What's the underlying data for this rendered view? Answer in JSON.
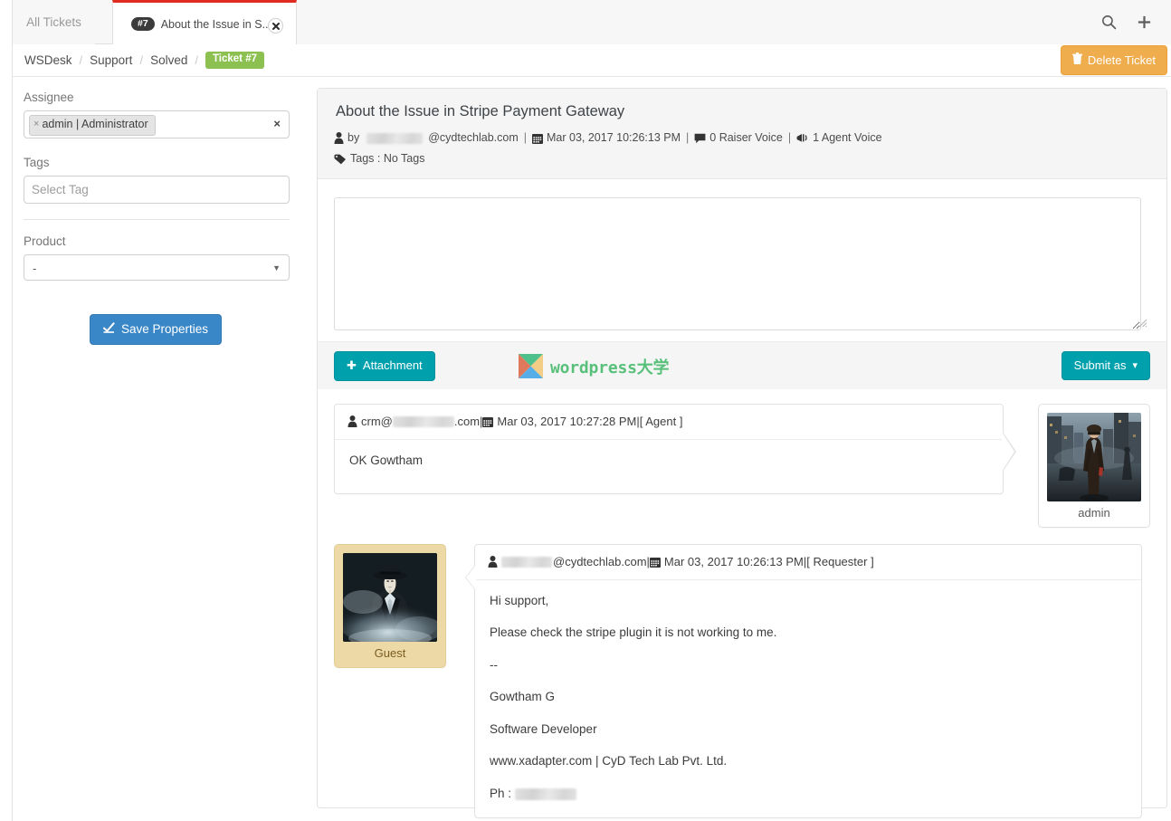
{
  "tabs": {
    "all_tickets_label": "All Tickets",
    "active": {
      "badge": "#7",
      "title": "About the Issue in S...",
      "close_label": "✖"
    }
  },
  "top_icons": {
    "search_name": "search-icon",
    "add_name": "plus-icon"
  },
  "breadcrumb": {
    "items": [
      "WSDesk",
      "Support",
      "Solved"
    ],
    "separator": "/",
    "current_badge": "Ticket #7"
  },
  "header": {
    "delete_label": "Delete Ticket"
  },
  "sidebar": {
    "assignee_label": "Assignee",
    "assignee_token": "admin | Administrator",
    "assignee_token_remove": "×",
    "assignee_clear": "×",
    "tags_label": "Tags",
    "tags_placeholder": "Select Tag",
    "product_label": "Product",
    "product_value": "-",
    "product_caret": "▼",
    "save_label": "Save Properties"
  },
  "ticket": {
    "title": "About the Issue in Stripe Payment Gateway",
    "by_prefix": "by",
    "requester_email_suffix": "@cydtechlab.com",
    "date": "Mar 03, 2017 10:26:13 PM",
    "raiser_voice": "0 Raiser Voice",
    "agent_voice": "1 Agent Voice",
    "tags_text": "Tags : No Tags",
    "separator": "|"
  },
  "composer": {
    "reply_value": "",
    "reply_placeholder": "",
    "attachment_label": "Attachment",
    "attachment_plus": "✚",
    "submit_label": "Submit as",
    "submit_caret": "▾",
    "watermark_text": "wordpress大学"
  },
  "messages": [
    {
      "email_prefix": "crm@",
      "email_suffix": ".com",
      "date": "Mar 03, 2017 10:27:28 PM",
      "role": "[ Agent ]",
      "separator": "|",
      "body_lines": [
        "OK Gowtham"
      ],
      "avatar_name": "admin",
      "side": "left"
    },
    {
      "email_prefix": "",
      "email_suffix": "@cydtechlab.com",
      "date": "Mar 03, 2017 10:26:13 PM",
      "role": "[ Requester ]",
      "separator": "|",
      "body_lines": [
        "Hi support,",
        "Please check the stripe plugin it is not working to me.",
        "--",
        "Gowtham G",
        "Software Developer",
        "www.xadapter.com | CyD Tech Lab Pvt. Ltd.",
        "Ph : "
      ],
      "avatar_name": "Guest",
      "side": "right"
    }
  ],
  "colors": {
    "accent_red": "#e02b20",
    "badge_green": "#8cc152",
    "delete_orange": "#f0ad4e",
    "teal": "#01a0ad",
    "blue": "#3a87c8",
    "guest_bg": "#ecd9a6"
  }
}
